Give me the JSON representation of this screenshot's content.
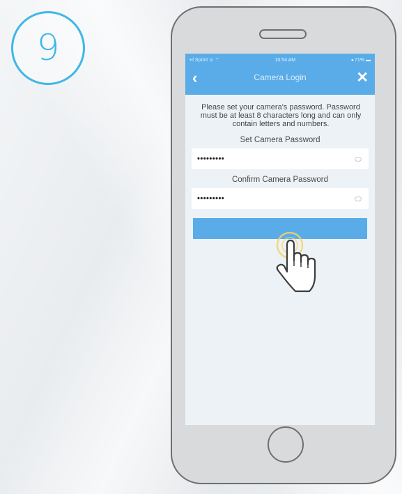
{
  "step": {
    "number": "9"
  },
  "phone": {
    "status_bar": {
      "carrier": "•ıl Sprint ᯤ ⌔",
      "time": "10:54 AM",
      "battery": "◂ 71% ▬"
    },
    "nav": {
      "title": "Camera Login",
      "back_icon": "chevron-left-icon",
      "close_icon": "close-icon"
    },
    "instructions": "Please set your camera's password. Password must be at least 8 characters long and can only contain letters and numbers.",
    "set_password": {
      "label": "Set Camera Password",
      "value": "•••••••••"
    },
    "confirm_password": {
      "label": "Confirm Camera Password",
      "value": "•••••••••"
    },
    "submit_button": {
      "label": ""
    }
  },
  "colors": {
    "accent": "#5aace8",
    "step_circle": "#3fb7e8"
  }
}
